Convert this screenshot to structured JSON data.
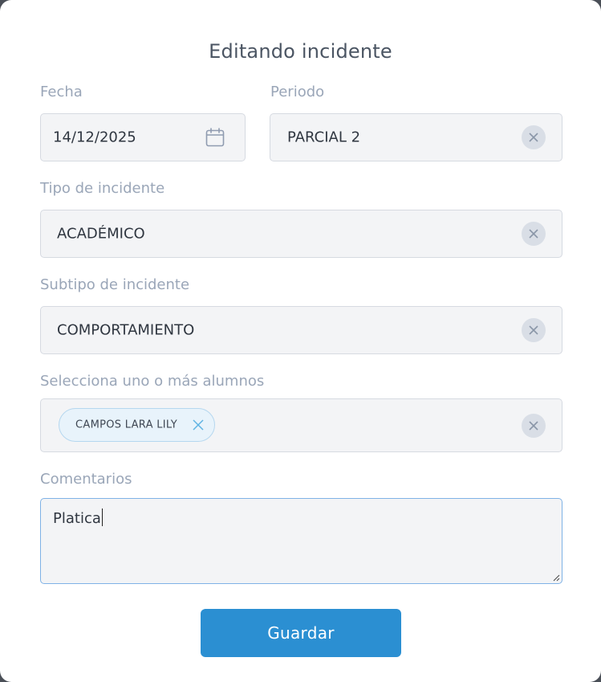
{
  "modal": {
    "title": "Editando incidente",
    "save_label": "Guardar"
  },
  "fecha": {
    "label": "Fecha",
    "value": "14/12/2025",
    "icon": "calendar-icon"
  },
  "periodo": {
    "label": "Periodo",
    "value": "PARCIAL 2"
  },
  "tipo": {
    "label": "Tipo de incidente",
    "value": "ACADÉMICO"
  },
  "subtipo": {
    "label": "Subtipo de incidente",
    "value": "COMPORTAMIENTO"
  },
  "alumnos": {
    "label": "Selecciona uno o más alumnos",
    "selected": [
      "CAMPOS LARA LILY"
    ]
  },
  "comentarios": {
    "label": "Comentarios",
    "value": "Platica"
  },
  "colors": {
    "accent": "#2b8fd2",
    "label": "#9aa6b8",
    "field_bg": "#f3f4f6",
    "chip_bg": "#e8f3fb"
  }
}
